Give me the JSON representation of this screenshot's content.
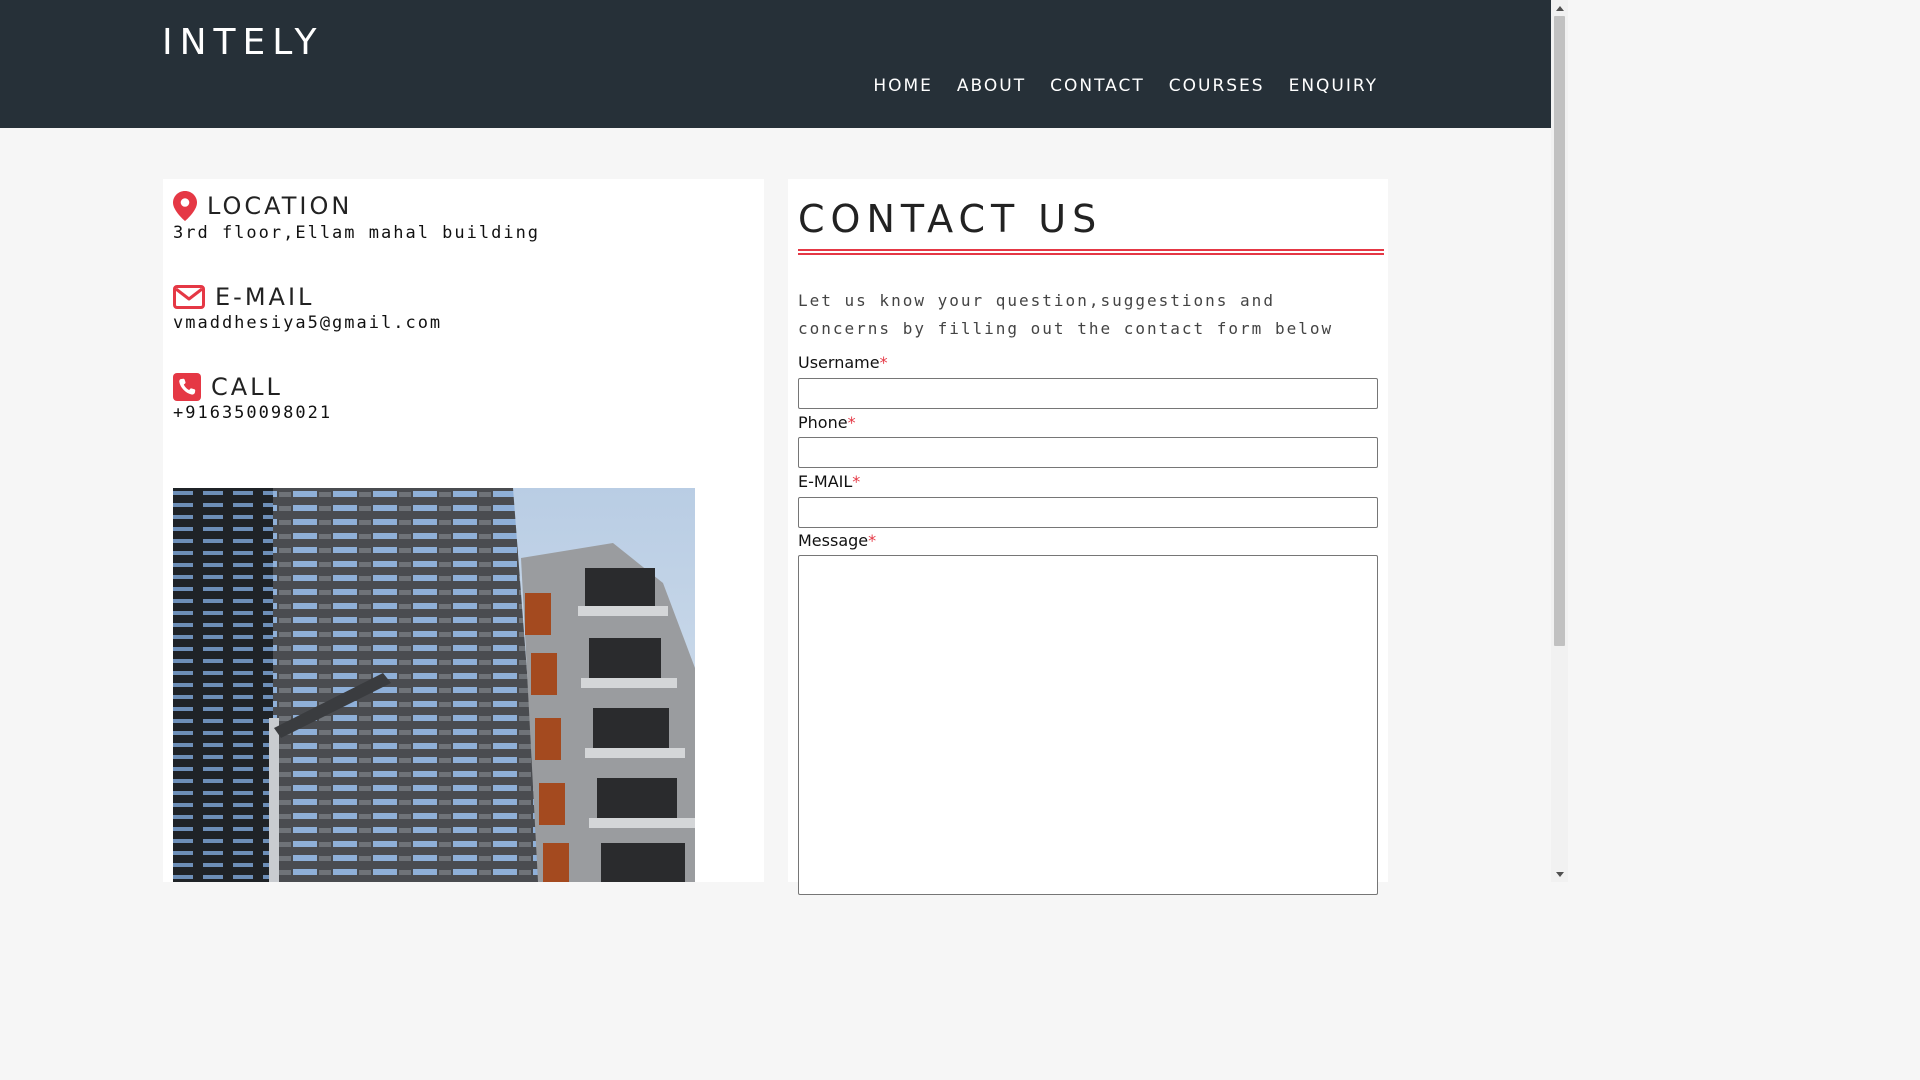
{
  "header": {
    "brand": "INTELY",
    "nav": [
      "HOME",
      "ABOUT",
      "CONTACT",
      "COURSES",
      "ENQUIRY"
    ]
  },
  "info": {
    "location": {
      "title": "LOCATION",
      "value": "3rd floor,Ellam mahal building",
      "icon": "location-pin-icon"
    },
    "email": {
      "title": "E-MAIL",
      "value": "vmaddhesiya5@gmail.com",
      "icon": "envelope-icon"
    },
    "call": {
      "title": "CALL",
      "value": "+916350098021",
      "icon": "phone-icon"
    }
  },
  "contact": {
    "title": "CONTACT US",
    "intro": "Let us know your question,suggestions and concerns by filling out the contact form below",
    "fields": {
      "username": {
        "label": "Username",
        "required_mark": "*",
        "value": ""
      },
      "phone": {
        "label": "Phone",
        "required_mark": "*",
        "value": ""
      },
      "email": {
        "label": "E-MAIL",
        "required_mark": "*",
        "value": ""
      },
      "message": {
        "label": "Message",
        "required_mark": "*",
        "value": ""
      }
    }
  },
  "colors": {
    "header_bg": "#263038",
    "accent": "#e53845",
    "page_bg": "#f6f6f6"
  }
}
